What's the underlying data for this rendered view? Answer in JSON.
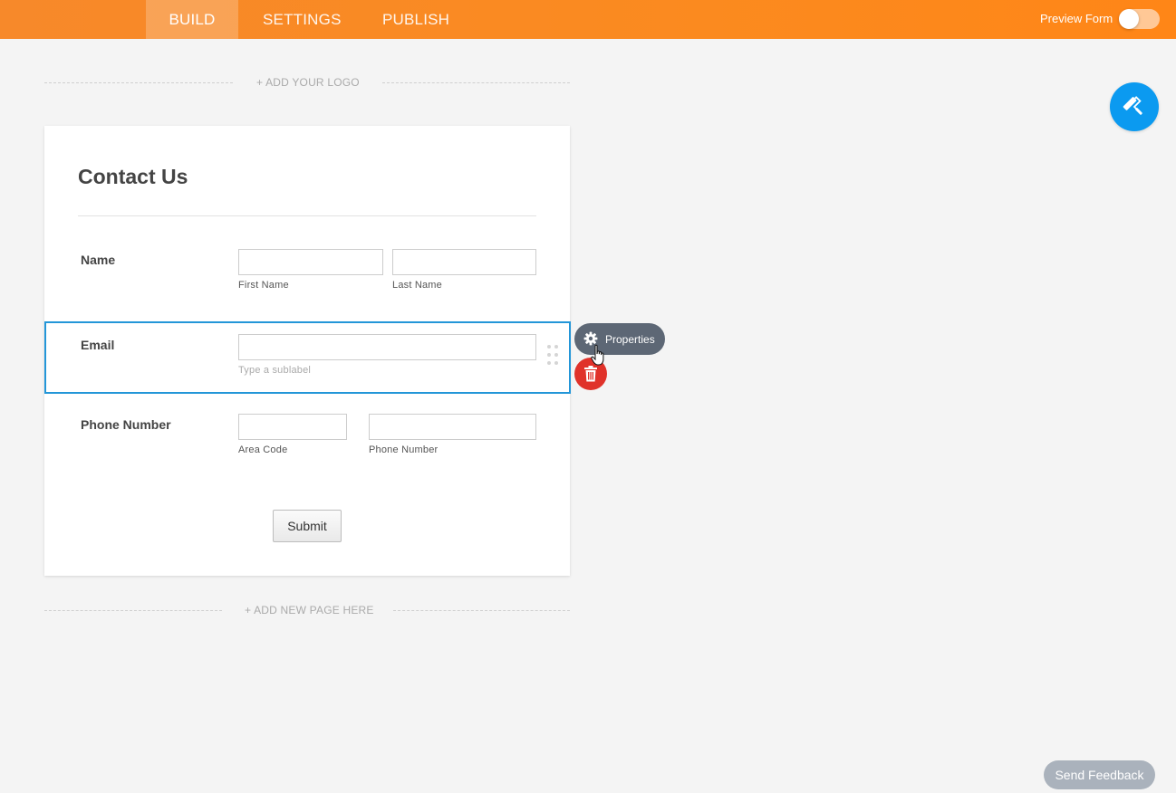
{
  "topbar": {
    "tabs": [
      {
        "label": "BUILD",
        "active": true
      },
      {
        "label": "SETTINGS",
        "active": false
      },
      {
        "label": "PUBLISH",
        "active": false
      }
    ],
    "preview_label": "Preview Form",
    "preview_on": false
  },
  "canvas": {
    "add_logo": "+ ADD YOUR LOGO",
    "add_page": "+ ADD NEW PAGE HERE"
  },
  "form": {
    "title": "Contact Us",
    "fields": {
      "name": {
        "label": "Name",
        "first_sublabel": "First Name",
        "last_sublabel": "Last Name",
        "first_value": "",
        "last_value": ""
      },
      "email": {
        "label": "Email",
        "sublabel_placeholder": "Type a sublabel",
        "value": ""
      },
      "phone": {
        "label": "Phone Number",
        "area_sublabel": "Area Code",
        "number_sublabel": "Phone Number",
        "area_value": "",
        "number_value": ""
      }
    },
    "submit_label": "Submit"
  },
  "floating": {
    "properties_label": "Properties",
    "icons": {
      "properties": "gear-icon",
      "delete": "trash-icon",
      "designer": "paint-roller-icon"
    }
  },
  "feedback_label": "Send Feedback",
  "colors": {
    "topbar_orange": "#fb8a1f",
    "selection_blue": "#2396d8",
    "designer_blue": "#0b9af0",
    "delete_red": "#e0322a",
    "properties_gray": "#5d6775",
    "feedback_gray": "#aab2bc"
  }
}
